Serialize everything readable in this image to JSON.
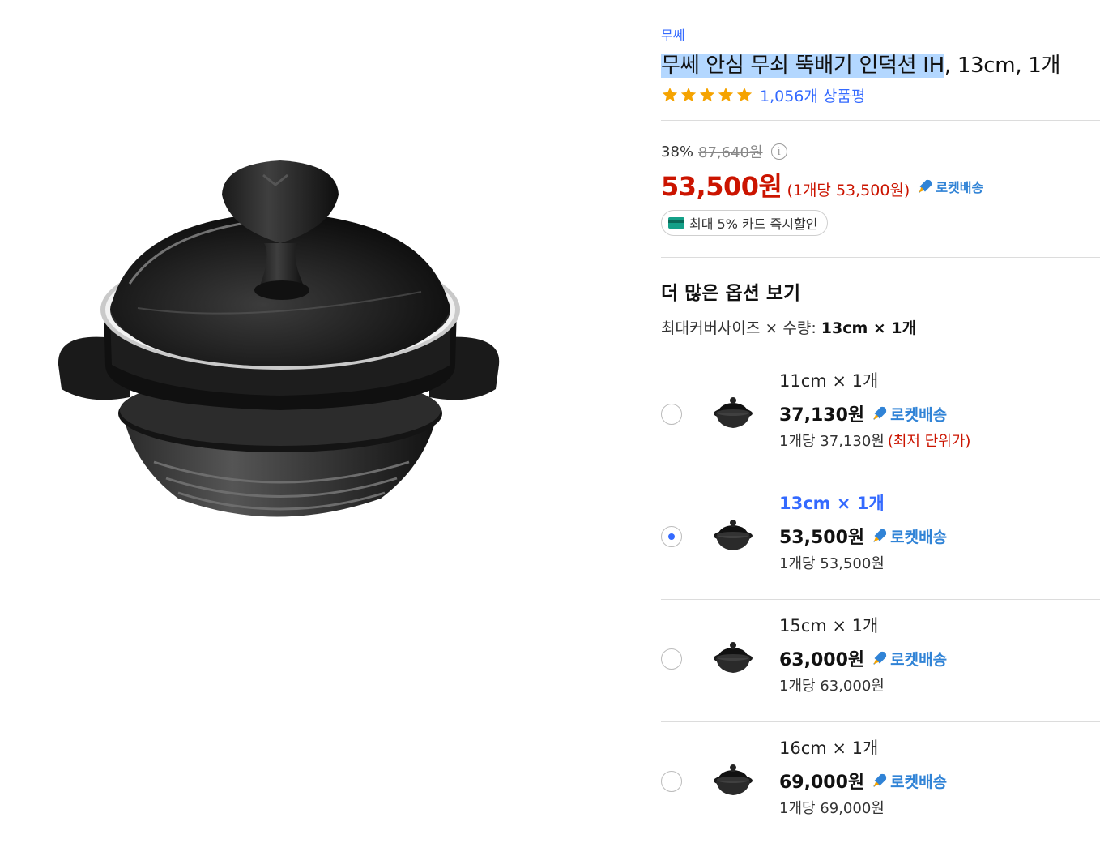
{
  "product": {
    "brand": "무쎄",
    "title_highlight": "무쎄 안심 무쇠 뚝배기 인덕션 IH",
    "title_rest": ", 13cm, 1개",
    "rating_stars": 5,
    "review_count": "1,056개 상품평"
  },
  "price": {
    "discount_rate": "38%",
    "original_price": "87,640원",
    "sale_price": "53,500원",
    "unit_price": "(1개당 53,500원)",
    "rocket_label": "로켓배송",
    "card_discount": "최대 5% 카드 즉시할인"
  },
  "options": {
    "heading": "더 많은 옵션 보기",
    "selected_prefix": "최대커버사이즈 × 수량: ",
    "selected_value": "13cm × 1개",
    "items": [
      {
        "name": "11cm × 1개",
        "price": "37,130원",
        "rocket": "로켓배송",
        "unit": "1개당 37,130원",
        "badge": "(최저 단위가)",
        "selected": false
      },
      {
        "name": "13cm × 1개",
        "price": "53,500원",
        "rocket": "로켓배송",
        "unit": "1개당 53,500원",
        "badge": "",
        "selected": true
      },
      {
        "name": "15cm × 1개",
        "price": "63,000원",
        "rocket": "로켓배송",
        "unit": "1개당 63,000원",
        "badge": "",
        "selected": false
      },
      {
        "name": "16cm × 1개",
        "price": "69,000원",
        "rocket": "로켓배송",
        "unit": "1개당 69,000원",
        "badge": "",
        "selected": false
      }
    ]
  },
  "colors": {
    "accent_blue": "#346aff",
    "sale_red": "#cb1400",
    "rocket_blue": "#3083d6",
    "star_orange": "#f5a300"
  }
}
